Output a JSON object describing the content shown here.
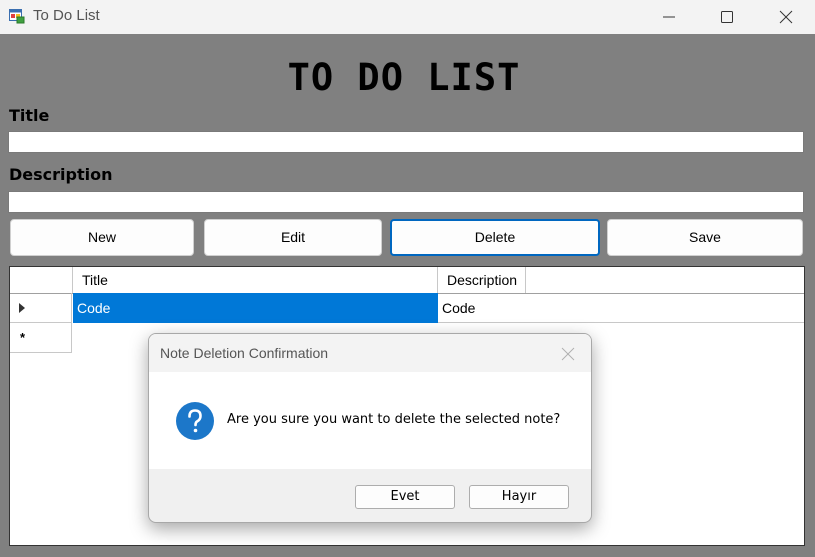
{
  "window": {
    "title": "To Do List",
    "icon": "app-form-icon",
    "controls": [
      "minimize-icon",
      "maximize-icon",
      "close-icon"
    ]
  },
  "form": {
    "heading": "TO DO LIST",
    "title_label": "Title",
    "title_value": "",
    "description_label": "Description",
    "description_value": "",
    "buttons": {
      "new": "New",
      "edit": "Edit",
      "delete": "Delete",
      "save": "Save"
    }
  },
  "grid": {
    "columns": [
      "Title",
      "Description"
    ],
    "rows": [
      {
        "title": "Code",
        "description": "Code",
        "selected": true
      }
    ],
    "new_row_marker": "*"
  },
  "dialog": {
    "title": "Note Deletion Confirmation",
    "message": "Are you sure you want to delete the selected note?",
    "icon": "question-icon",
    "buttons": {
      "yes": "Evet",
      "no": "Hayır"
    }
  },
  "colors": {
    "form_background": "#808080",
    "selection": "#0078d7",
    "focus_border": "#0067c0",
    "question_icon": "#1c77c9"
  }
}
